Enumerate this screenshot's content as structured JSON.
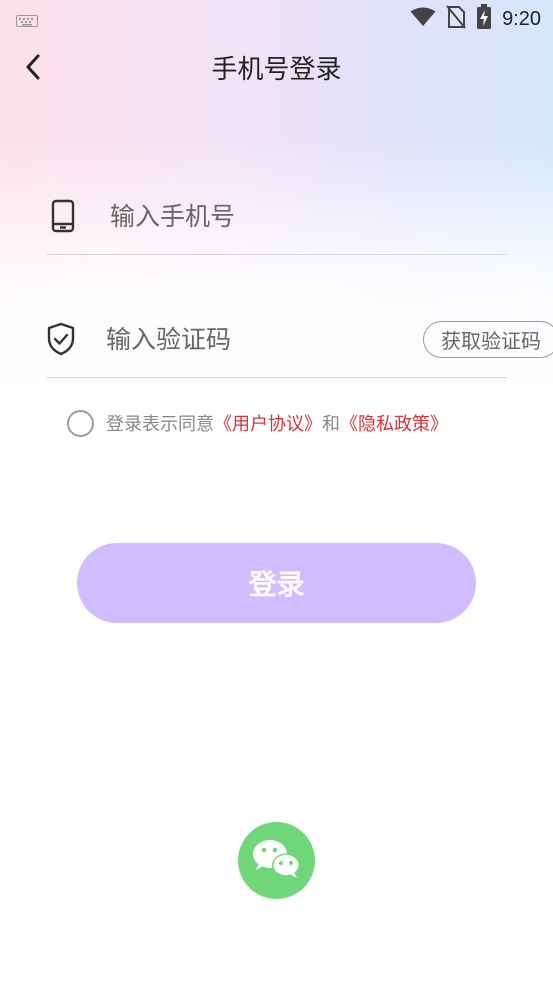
{
  "status_bar": {
    "time": "9:20",
    "icons": [
      "keyboard-icon",
      "wifi-icon",
      "no-sim-icon",
      "battery-charging-icon"
    ]
  },
  "header": {
    "back_icon": "chevron-left-icon",
    "title": "手机号登录"
  },
  "form": {
    "phone": {
      "icon": "phone-icon",
      "placeholder": "输入手机号",
      "value": ""
    },
    "code": {
      "icon": "shield-check-icon",
      "placeholder": "输入验证码",
      "value": "",
      "get_code_label": "获取验证码"
    }
  },
  "agreement": {
    "checked": false,
    "prefix": "登录表示同意",
    "user_agreement": "《用户协议》",
    "conjunction": "和",
    "privacy_policy": "《隐私政策》"
  },
  "login_button": {
    "label": "登录"
  },
  "social_login": {
    "wechat_icon": "wechat-icon"
  },
  "colors": {
    "accent_button": "#d1bcff",
    "link_red": "#d6323a",
    "wechat_green": "#6fd67a"
  }
}
